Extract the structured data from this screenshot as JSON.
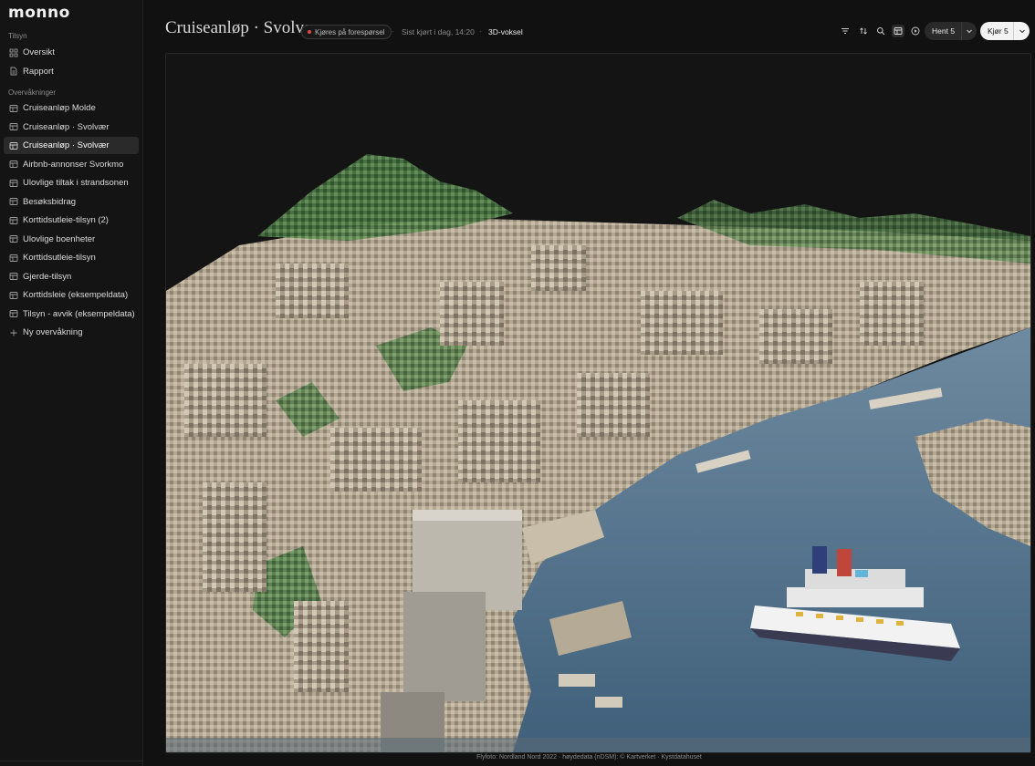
{
  "app": {
    "logo": "monno"
  },
  "sidebar": {
    "section_tilsyn": "Tilsyn",
    "section_overvakninger": "Overvåkninger",
    "top_items": [
      {
        "label": "Oversikt",
        "icon": "grid-icon"
      },
      {
        "label": "Rapport",
        "icon": "document-icon"
      }
    ],
    "items": [
      {
        "label": "Cruiseanløp Molde",
        "icon": "table-icon",
        "active": false
      },
      {
        "label": "Cruiseanløp · Svolvær",
        "icon": "table-icon",
        "active": false
      },
      {
        "label": "Cruiseanløp · Svolvær",
        "icon": "table-icon",
        "active": true
      },
      {
        "label": "Airbnb-annonser Svorkmo",
        "icon": "table-icon",
        "active": false
      },
      {
        "label": "Ulovlige tiltak i strandsonen",
        "icon": "table-icon",
        "active": false
      },
      {
        "label": "Besøksbidrag",
        "icon": "table-icon",
        "active": false
      },
      {
        "label": "Korttidsutleie-tilsyn (2)",
        "icon": "table-icon",
        "active": false
      },
      {
        "label": "Ulovlige boenheter",
        "icon": "table-icon",
        "active": false
      },
      {
        "label": "Korttidsutleie-tilsyn",
        "icon": "table-icon",
        "active": false
      },
      {
        "label": "Gjerde-tilsyn",
        "icon": "table-icon",
        "active": false
      },
      {
        "label": "Korttidsleie (eksempeldata)",
        "icon": "table-icon",
        "active": false
      },
      {
        "label": "Tilsyn - avvik (eksempeldata)",
        "icon": "table-icon",
        "active": false
      }
    ],
    "new_item": {
      "label": "Ny overvåkning",
      "icon": "plus-icon"
    }
  },
  "header": {
    "title": "Cruiseanløp · Svolvær",
    "status": "Kjøres på forespørsel",
    "status_color": "#e2493c",
    "separator": "·",
    "last_run": "Sist kjørt i dag, 14:20",
    "view_mode": "3D-voksel"
  },
  "toolbar": {
    "icons": [
      "filter-icon",
      "sort-icon",
      "search-icon",
      "layout-icon",
      "play-circle-icon"
    ],
    "fetch_label": "Hent 5",
    "run_label": "Kjør 5"
  },
  "viewport": {
    "credit": "Flyfoto: Nordland Nord 2022 · høydedata (nDSM): © Kartverket · Kystdatahuset"
  }
}
